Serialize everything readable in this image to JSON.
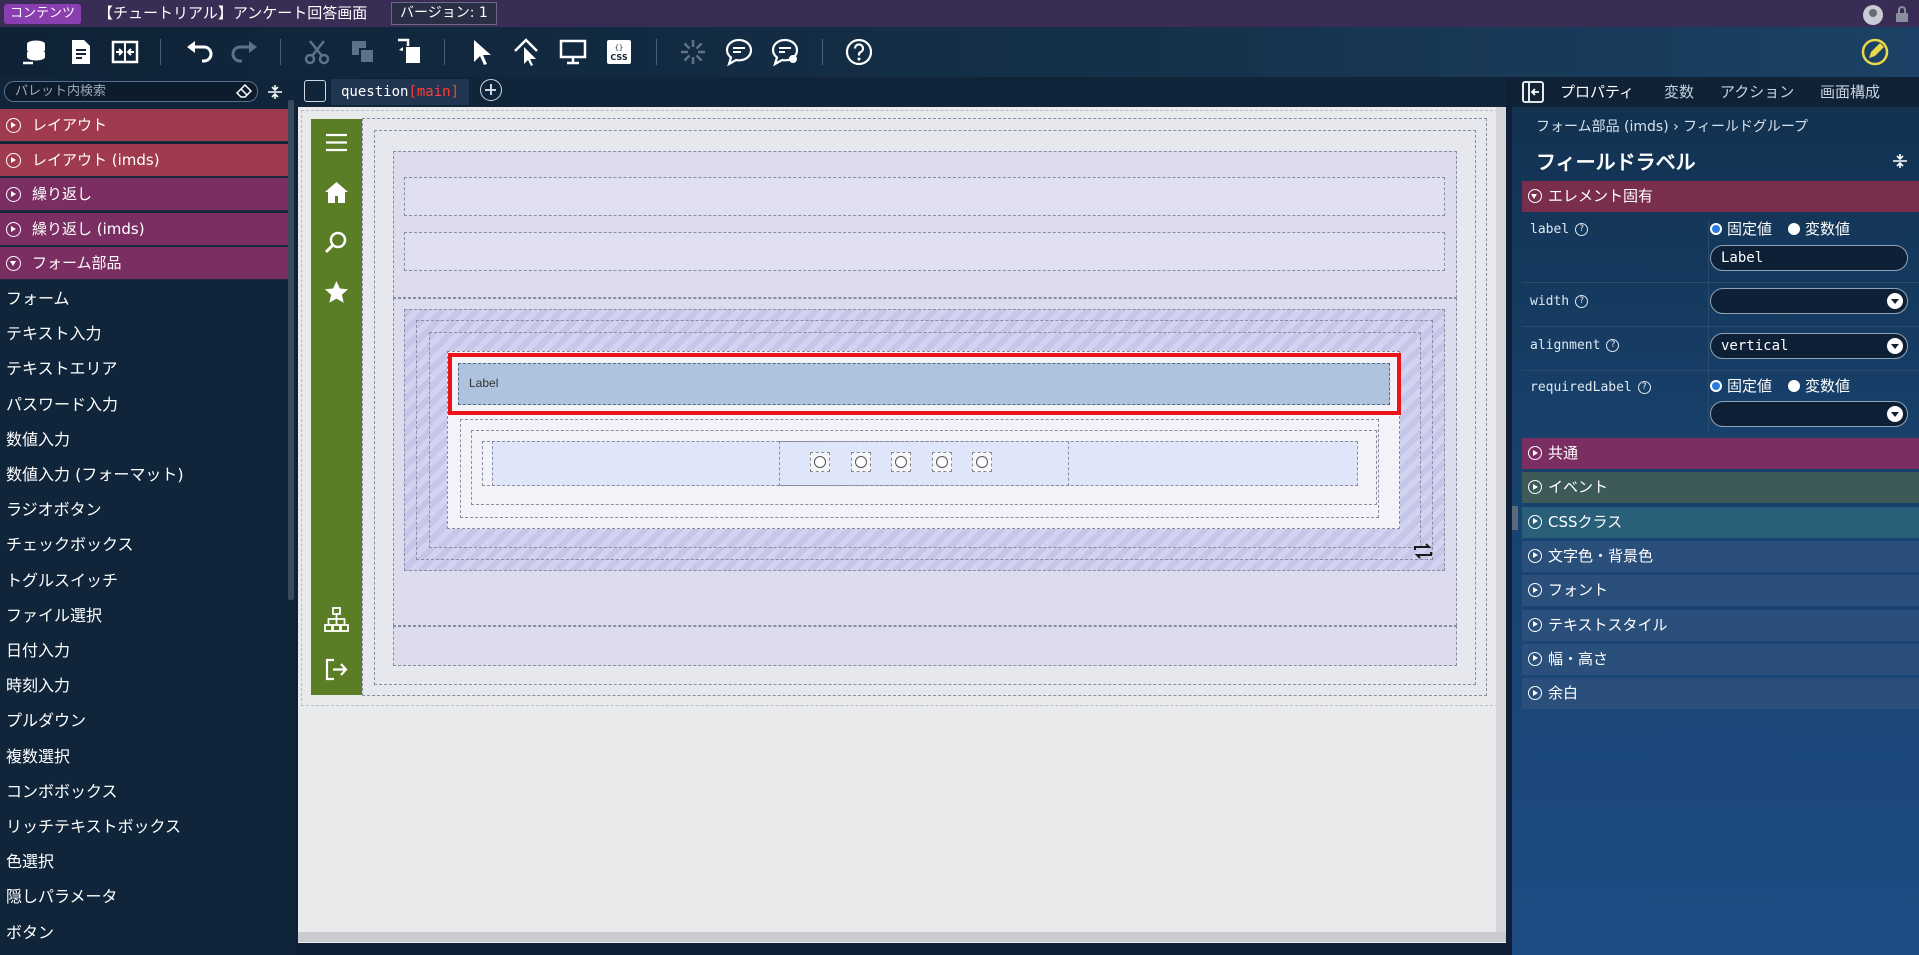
{
  "titlebar": {
    "badge": "コンテンツ",
    "title": "【チュートリアル】アンケート回答画面",
    "version": "バージョン: 1"
  },
  "palette": {
    "search_placeholder": "パレット内検索",
    "categories": [
      {
        "label": "レイアウト",
        "color": "#a03a4e"
      },
      {
        "label": "レイアウト (imds)",
        "color": "#a03a4e"
      },
      {
        "label": "繰り返し",
        "color": "#7a2e62"
      },
      {
        "label": "繰り返し (imds)",
        "color": "#7a2e62"
      },
      {
        "label": "フォーム部品",
        "color": "#7a2e62"
      }
    ],
    "items": [
      "フォーム",
      "テキスト入力",
      "テキストエリア",
      "パスワード入力",
      "数値入力",
      "数値入力 (フォーマット)",
      "ラジオボタン",
      "チェックボックス",
      "トグルスイッチ",
      "ファイル選択",
      "日付入力",
      "時刻入力",
      "プルダウン",
      "複数選択",
      "コンボボックス",
      "リッチテキストボックス",
      "色選択",
      "隠しパラメータ",
      "ボタン"
    ]
  },
  "tab": {
    "name": "question",
    "suffix": "[main]"
  },
  "canvas": {
    "label_text": "Label"
  },
  "panel": {
    "tabs": [
      "プロパティ",
      "変数",
      "アクション",
      "画面構成"
    ],
    "breadcrumb": "フォーム部品 (imds)  ›  フィールドグループ",
    "title": "フィールドラベル",
    "section_open": "エレメント固有",
    "props": {
      "label": {
        "name": "label",
        "fixed": "固定値",
        "var": "変数値",
        "value": "Label"
      },
      "width": {
        "name": "width"
      },
      "alignment": {
        "name": "alignment",
        "value": "vertical"
      },
      "requiredLabel": {
        "name": "requiredLabel",
        "fixed": "固定値",
        "var": "変数値"
      }
    },
    "sections": [
      {
        "label": "共通",
        "color": "#7a2e62"
      },
      {
        "label": "イベント",
        "color": "#3e5a58"
      },
      {
        "label": "CSSクラス",
        "color": "#2a5f7a"
      },
      {
        "label": "文字色・背景色",
        "color": "#2a4f7a"
      },
      {
        "label": "フォント",
        "color": "#2a4f7a"
      },
      {
        "label": "テキストスタイル",
        "color": "#2a4f7a"
      },
      {
        "label": "幅・高さ",
        "color": "#2a4f7a"
      },
      {
        "label": "余白",
        "color": "#2a4f7a"
      }
    ]
  }
}
